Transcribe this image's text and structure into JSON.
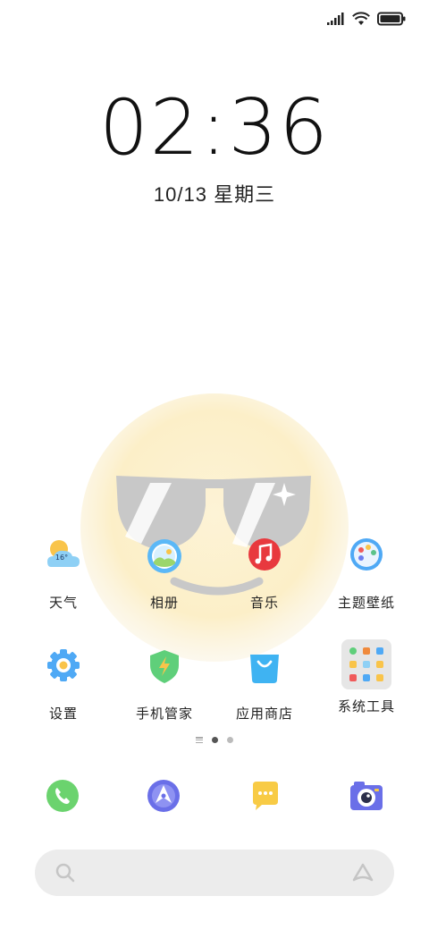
{
  "status_bar": {
    "signal_icon": "signal-bars-icon",
    "wifi_icon": "wifi-icon",
    "battery_icon": "battery-icon",
    "battery_level": 1.0
  },
  "lockscreen": {
    "time": "02:36",
    "date": "10/13 星期三"
  },
  "weather_widget": {
    "temperature": "16°"
  },
  "apps": [
    {
      "label": "天气",
      "icon": "weather-icon"
    },
    {
      "label": "相册",
      "icon": "gallery-icon"
    },
    {
      "label": "音乐",
      "icon": "music-icon"
    },
    {
      "label": "主题壁纸",
      "icon": "themes-icon"
    },
    {
      "label": "设置",
      "icon": "settings-icon"
    },
    {
      "label": "手机管家",
      "icon": "security-icon"
    },
    {
      "label": "应用商店",
      "icon": "app-store-icon"
    },
    {
      "label": "系统工具",
      "icon": "system-tools-folder-icon"
    }
  ],
  "pager": {
    "pages": 2,
    "current": 1
  },
  "dock": [
    {
      "icon": "phone-icon"
    },
    {
      "icon": "browser-icon"
    },
    {
      "icon": "messages-icon"
    },
    {
      "icon": "camera-icon"
    }
  ],
  "search": {
    "search_icon": "search-icon",
    "assistant_icon": "assistant-icon"
  },
  "colors": {
    "wallpaper_face": "#FCEFC8",
    "clock_text": "#111111",
    "search_bg": "#ECECEC"
  }
}
